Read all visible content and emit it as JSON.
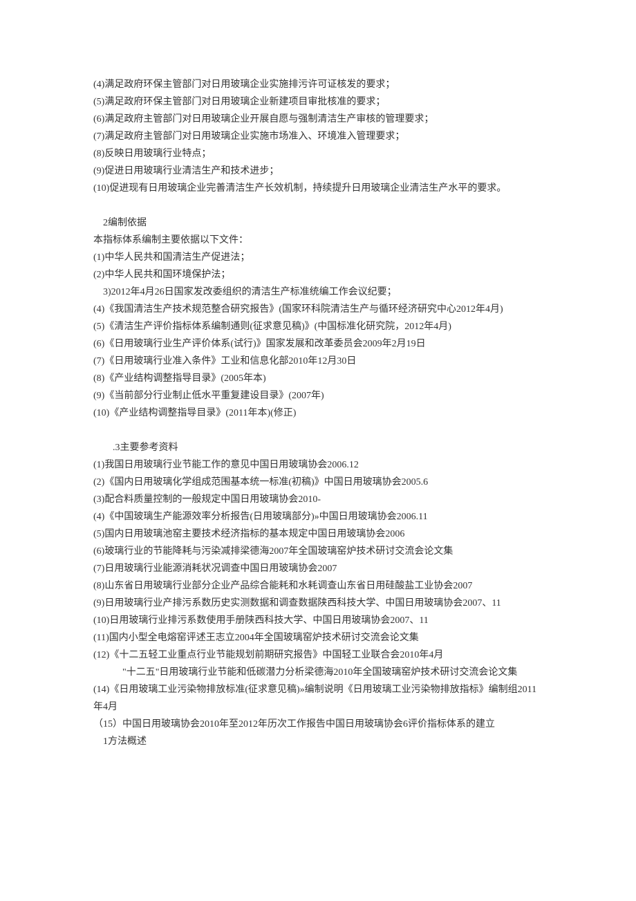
{
  "section1": {
    "items": [
      "(4)满足政府环保主管部门对日用玻璃企业实施排污许可证核发的要求；",
      "(5)满足政府环保主管部门对日用玻璃企业新建项目审批核准的要求；",
      "(6)满足政府主管部门对日用玻璃企业开展自愿与强制清洁生产审核的管理要求；",
      "(7)满足政府主管部门对日用玻璃企业实施市场准入、环境准入管理要求；",
      "(8)反映日用玻璃行业特点；",
      "(9)促进日用玻璃行业清洁生产和技术进步；",
      "(10)促进现有日用玻璃企业完善清洁生产长效机制，持续提升日用玻璃企业清洁生产水平的要求。"
    ]
  },
  "section2": {
    "title": "2编制依据",
    "intro": "本指标体系编制主要依据以下文件：",
    "items": [
      "(1)中华人民共和国清洁生产促进法；",
      "(2)中华人民共和国环境保护法；",
      "　3)2012年4月26日国家发改委组织的清洁生产标准统编工作会议纪要；",
      "(4)《我国清洁生产技术规范整合研究报告》(国家环科院清洁生产与循环经济研究中心2012年4月)",
      "(5)《清洁生产评价指标体系编制通则(征求意见稿)》(中国标准化研究院，2012年4月)",
      "(6)《日用玻璃行业生产评价体系(试行)》国家发展和改革委员会2009年2月19日",
      "(7)《日用玻璃行业准入条件》工业和信息化部2010年12月30日",
      "(8)《产业结构调整指导目录》(2005年本)",
      "(9)《当前部分行业制止低水平重复建设目录》(2007年)",
      "(10)《产业结构调整指导目录》(2011年本)(修正)"
    ]
  },
  "section3": {
    "title": ".3主要参考资料",
    "items": [
      "(1)我国日用玻璃行业节能工作的意见中国日用玻璃协会2006.12",
      "(2)《国内日用玻璃化学组成范围基本统一标准(初稿)》中国日用玻璃协会2005.6",
      "(3)配合料质量控制的一般规定中国日用玻璃协会2010-",
      "(4)《中国玻璃生产能源效率分析报告(日用玻璃部分)»中国日用玻璃协会2006.11",
      "(5)国内日用玻璃池窑主要技术经济指标的基本规定中国日用玻璃协会2006",
      "(6)玻璃行业的节能降耗与污染减排梁德海2007年全国玻璃窑炉技术研讨交流会论文集",
      "(7)日用玻璃行业能源消耗状况调查中国日用玻璃协会2007",
      "(8)山东省日用玻璃行业部分企业产品综合能耗和水耗调查山东省日用硅酸盐工业协会2007",
      "(9)日用玻璃行业产排污系数历史实测数据和调查数据陕西科技大学、中国日用玻璃协会2007、11",
      "(10)日用玻璃行业排污系数使用手册陕西科技大学、中国日用玻璃协会2007、11",
      "(11)国内小型全电熔窑评述王志立2004年全国玻璃窑炉技术研讨交流会论文集",
      "(12)《十二五轻工业重点行业节能规划前期研究报告》中国轻工业联合会2010年4月",
      "　　　\"十二五\"日用玻璃行业节能和低碳潜力分析梁德海2010年全国玻璃窑炉技术研讨交流会论文集",
      "(14)《日用玻璃工业污染物排放标准(征求意见稿)»编制说明《日用玻璃工业污染物排放指标》编制组2011年4月",
      "（15）中国日用玻璃协会2010年至2012年历次工作报告中国日用玻璃协会6评价指标体系的建立"
    ],
    "closing": "1方法概述"
  }
}
